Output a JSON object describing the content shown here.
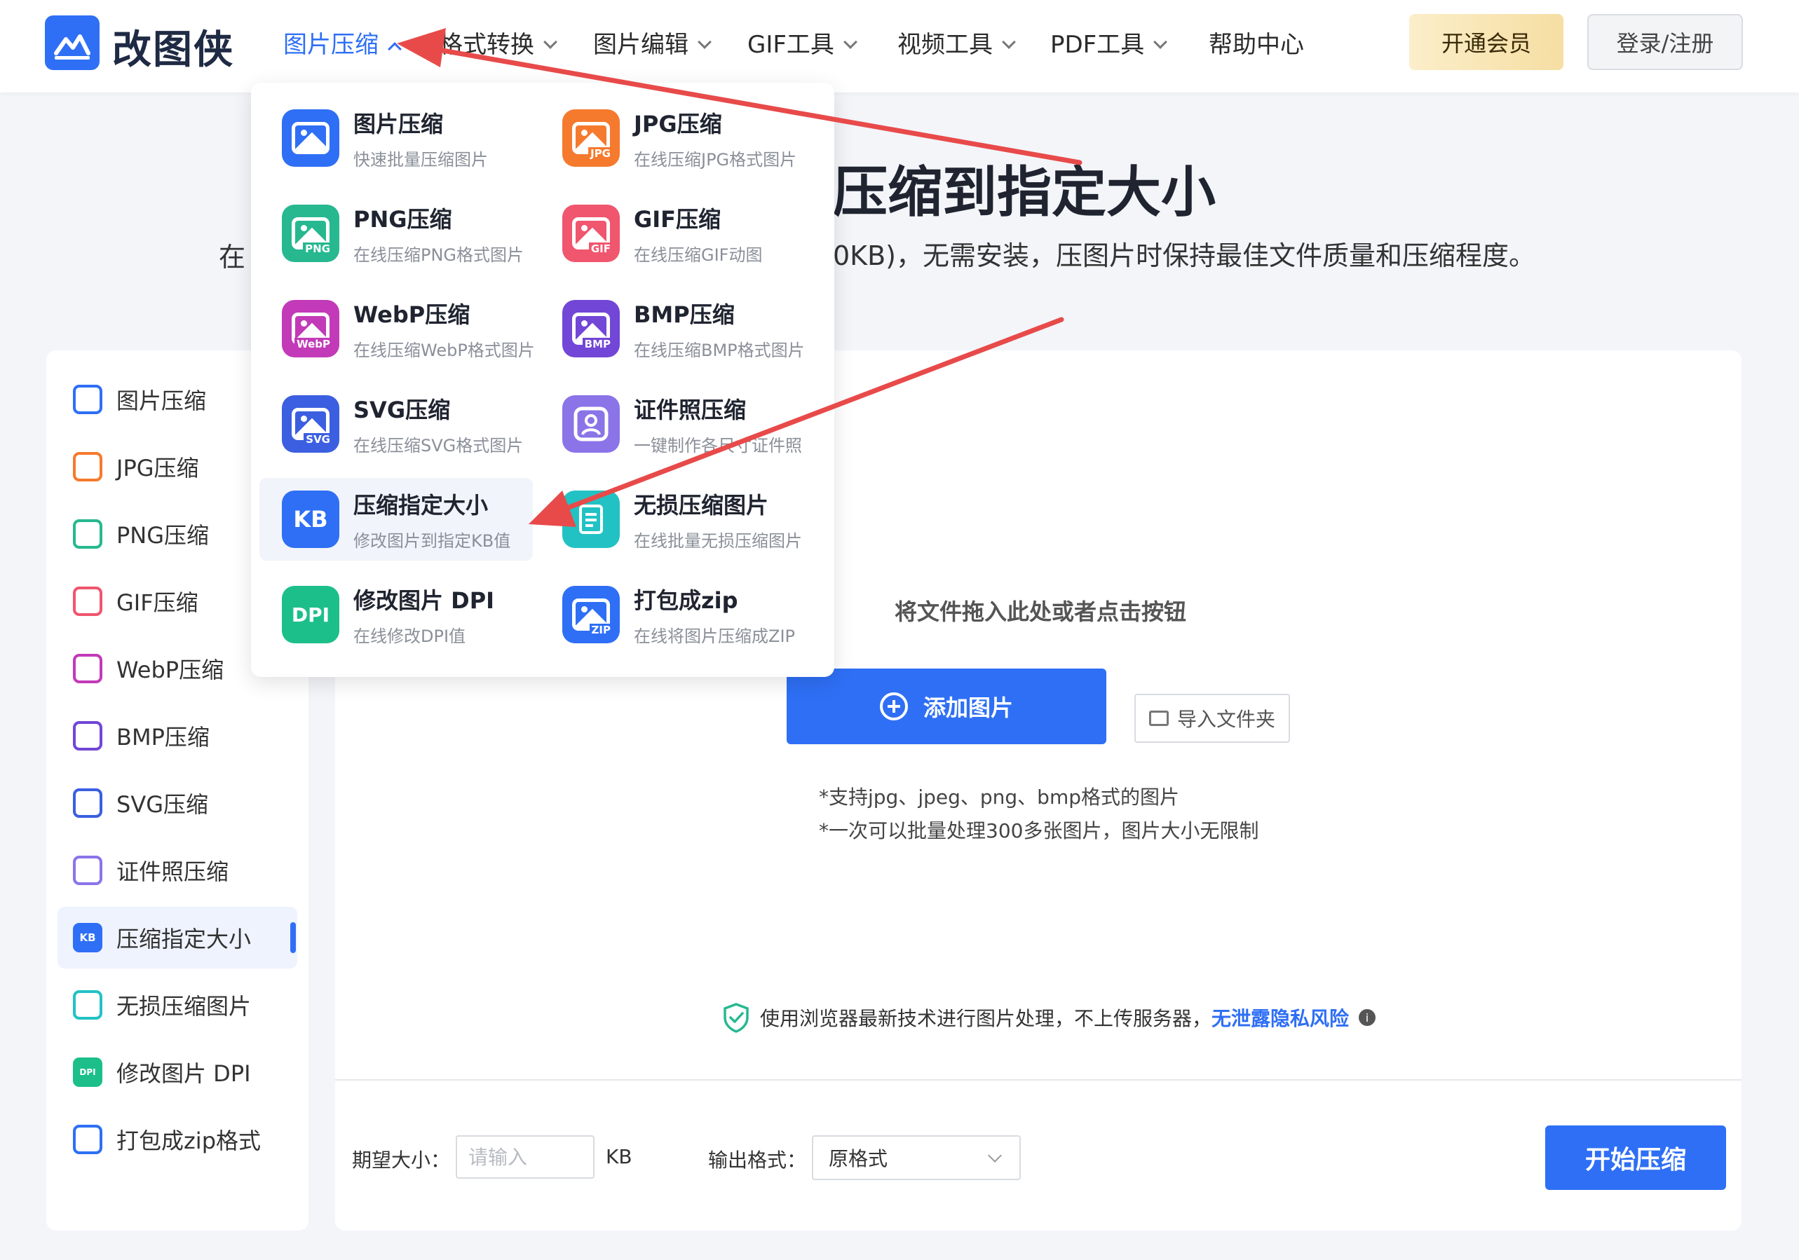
{
  "header": {
    "logo_text": "改图侠",
    "nav": [
      {
        "label": "图片压缩"
      },
      {
        "label": "格式转换"
      },
      {
        "label": "图片编辑"
      },
      {
        "label": "GIF工具"
      },
      {
        "label": "视频工具"
      },
      {
        "label": "PDF工具"
      },
      {
        "label": "帮助中心"
      }
    ],
    "vip_label": "开通会员",
    "login_label": "登录/注册"
  },
  "hero": {
    "title_visible": "压缩到指定大小",
    "subtitle_left_visible": "在",
    "subtitle_right_visible": "0KB)，无需安装，压图片时保持最佳文件质量和压缩程度。"
  },
  "dropdown": {
    "items": [
      {
        "title": "图片压缩",
        "desc": "快速批量压缩图片",
        "color": "#2e6ff5"
      },
      {
        "title": "JPG压缩",
        "desc": "在线压缩JPG格式图片",
        "color": "#f57a2e",
        "tag": "JPG"
      },
      {
        "title": "PNG压缩",
        "desc": "在线压缩PNG格式图片",
        "color": "#27b890",
        "tag": "PNG"
      },
      {
        "title": "GIF压缩",
        "desc": "在线压缩GIF动图",
        "color": "#f0566e",
        "tag": "GIF"
      },
      {
        "title": "WebP压缩",
        "desc": "在线压缩WebP格式图片",
        "color": "#c23ab8",
        "tag": "WebP"
      },
      {
        "title": "BMP压缩",
        "desc": "在线压缩BMP格式图片",
        "color": "#7246d6",
        "tag": "BMP"
      },
      {
        "title": "SVG压缩",
        "desc": "在线压缩SVG格式图片",
        "color": "#3b5fe0",
        "tag": "SVG"
      },
      {
        "title": "证件照压缩",
        "desc": "一键制作各尺寸证件照",
        "color": "#8b74e8"
      },
      {
        "title": "压缩指定大小",
        "desc": "修改图片到指定KB值",
        "color": "#2e6ff5",
        "icon_text": "KB"
      },
      {
        "title": "无损压缩图片",
        "desc": "在线批量无损压缩图片",
        "color": "#22c2c4"
      },
      {
        "title": "修改图片 DPI",
        "desc": "在线修改DPI值",
        "color": "#1cbf8a",
        "icon_text": "DPI"
      },
      {
        "title": "打包成zip",
        "desc": "在线将图片压缩成ZIP",
        "color": "#2e6ff5",
        "tag": "ZIP"
      }
    ]
  },
  "sidebar": {
    "items": [
      {
        "label": "图片压缩",
        "color": "#2e6ff5"
      },
      {
        "label": "JPG压缩",
        "color": "#f57a2e"
      },
      {
        "label": "PNG压缩",
        "color": "#27b890"
      },
      {
        "label": "GIF压缩",
        "color": "#f0566e"
      },
      {
        "label": "WebP压缩",
        "color": "#c23ab8"
      },
      {
        "label": "BMP压缩",
        "color": "#7246d6"
      },
      {
        "label": "SVG压缩",
        "color": "#3b5fe0"
      },
      {
        "label": "证件照压缩",
        "color": "#8b74e8"
      },
      {
        "label": "压缩指定大小",
        "color": "#2e6ff5",
        "icon_text": "KB"
      },
      {
        "label": "无损压缩图片",
        "color": "#22c2c4"
      },
      {
        "label": "修改图片 DPI",
        "color": "#1cbf8a",
        "icon_text": "DPI"
      },
      {
        "label": "打包成zip格式",
        "color": "#2e6ff5"
      }
    ]
  },
  "upload": {
    "drop_hint": "将文件拖入此处或者点击按钮",
    "add_label": "添加图片",
    "folder_label": "导入文件夹",
    "support_1": "*支持jpg、jpeg、png、bmp格式的图片",
    "support_2": "*一次可以批量处理300多张图片，图片大小无限制",
    "privacy_text": "使用浏览器最新技术进行图片处理，不上传服务器，",
    "privacy_link": "无泄露隐私风险"
  },
  "options": {
    "size_label": "期望大小：",
    "size_placeholder": "请输入",
    "size_unit": "KB",
    "format_label": "输出格式：",
    "format_value": "原格式",
    "start_label": "开始压缩"
  },
  "colors": {
    "brand": "#2e6ff5",
    "annotation_arrow": "#e84a4a"
  }
}
